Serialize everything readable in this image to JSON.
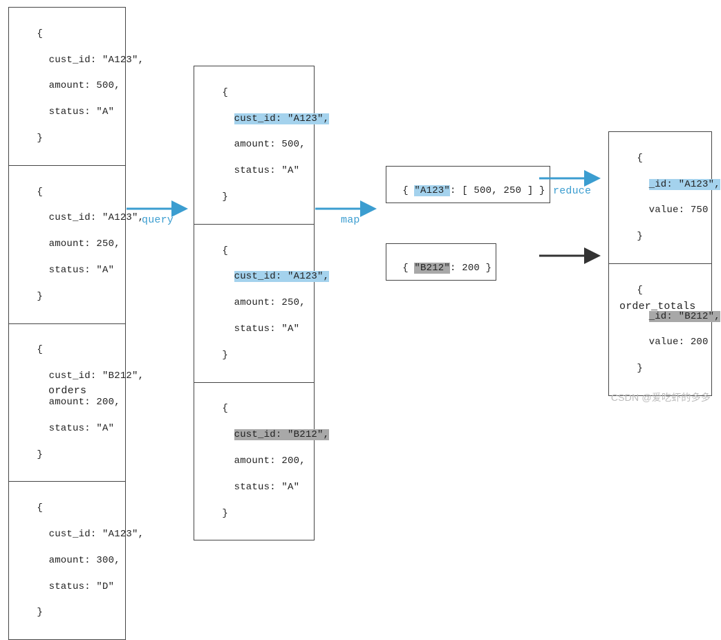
{
  "colors": {
    "accent": "#3b9dd0",
    "highlight_blue": "#a4d2ed",
    "highlight_gray": "#a8a8a8"
  },
  "labels": {
    "orders": "orders",
    "order_totals": "order_totals",
    "query": "query",
    "map": "map",
    "reduce": "reduce"
  },
  "orders": [
    {
      "brace_open": "{",
      "cust_id": "  cust_id: \"A123\",",
      "amount": "  amount: 500,",
      "status": "  status: \"A\"",
      "brace_close": "}"
    },
    {
      "brace_open": "{",
      "cust_id": "  cust_id: \"A123\",",
      "amount": "  amount: 250,",
      "status": "  status: \"A\"",
      "brace_close": "}"
    },
    {
      "brace_open": "{",
      "cust_id": "  cust_id: \"B212\",",
      "amount": "  amount: 200,",
      "status": "  status: \"A\"",
      "brace_close": "}"
    },
    {
      "brace_open": "{",
      "cust_id": "  cust_id: \"A123\",",
      "amount": "  amount: 300,",
      "status": "  status: \"D\"",
      "brace_close": "}"
    }
  ],
  "queried": [
    {
      "brace_open": "{",
      "cust_pre": "  ",
      "cust_hl": "cust_id: \"A123\",",
      "amount": "  amount: 500,",
      "status": "  status: \"A\"",
      "brace_close": "}",
      "hl": "blue"
    },
    {
      "brace_open": "{",
      "cust_pre": "  ",
      "cust_hl": "cust_id: \"A123\",",
      "amount": "  amount: 250,",
      "status": "  status: \"A\"",
      "brace_close": "}",
      "hl": "blue"
    },
    {
      "brace_open": "{",
      "cust_pre": "  ",
      "cust_hl": "cust_id: \"B212\",",
      "amount": "  amount: 200,",
      "status": "  status: \"A\"",
      "brace_close": "}",
      "hl": "gray"
    }
  ],
  "mapped": [
    {
      "open": "{ ",
      "key": "\"A123\"",
      "rest": ": [ 500, 250 ] }",
      "hl": "blue"
    },
    {
      "open": "{ ",
      "key": "\"B212\"",
      "rest": ": 200 }",
      "hl": "gray"
    }
  ],
  "totals": [
    {
      "brace_open": "{",
      "id_pre": "  ",
      "id_hl": "_id: \"A123\",",
      "value": "  value: 750",
      "brace_close": "}",
      "hl": "blue"
    },
    {
      "brace_open": "{",
      "id_pre": "  ",
      "id_hl": "_id: \"B212\",",
      "value": "  value: 200",
      "brace_close": "}",
      "hl": "gray"
    }
  ],
  "watermark": "CSDN @爱吃虾的多多"
}
